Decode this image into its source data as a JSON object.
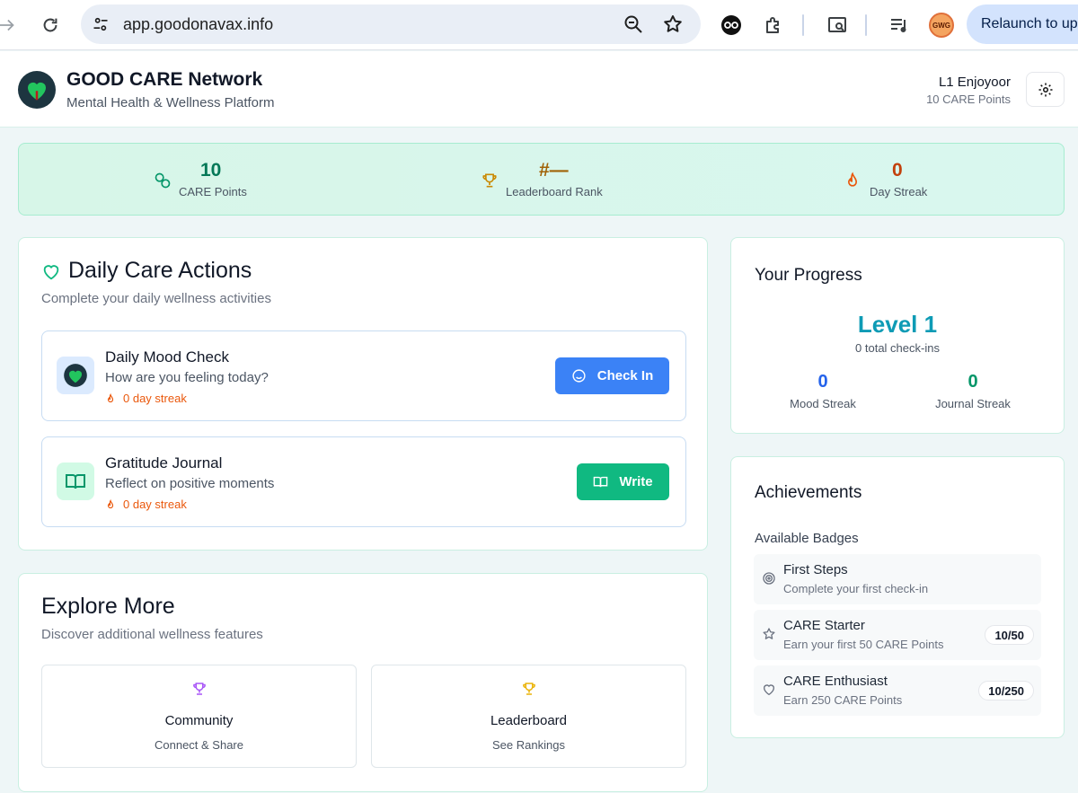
{
  "browser": {
    "url": "app.goodonavax.info",
    "relaunch_label": "Relaunch to update",
    "profile_initials": "GWG"
  },
  "header": {
    "title": "GOOD CARE Network",
    "subtitle": "Mental Health & Wellness Platform",
    "user_name": "L1 Enjoyoor",
    "user_points": "10 CARE Points"
  },
  "stats": {
    "points_value": "10",
    "points_label": "CARE Points",
    "rank_value": "#—",
    "rank_label": "Leaderboard Rank",
    "streak_value": "0",
    "streak_label": "Day Streak"
  },
  "daily": {
    "title": "Daily Care Actions",
    "subtitle": "Complete your daily wellness activities",
    "mood": {
      "title": "Daily Mood Check",
      "description": "How are you feeling today?",
      "streak": "0 day streak",
      "button": "Check In"
    },
    "journal": {
      "title": "Gratitude Journal",
      "description": "Reflect on positive moments",
      "streak": "0 day streak",
      "button": "Write"
    }
  },
  "explore": {
    "title": "Explore More",
    "subtitle": "Discover additional wellness features",
    "items": [
      {
        "title": "Community",
        "description": "Connect & Share"
      },
      {
        "title": "Leaderboard",
        "description": "See Rankings"
      }
    ]
  },
  "progress": {
    "title": "Your Progress",
    "level": "Level 1",
    "checkins": "0 total check-ins",
    "mood_streak_value": "0",
    "mood_streak_label": "Mood Streak",
    "journal_streak_value": "0",
    "journal_streak_label": "Journal Streak"
  },
  "achievements": {
    "title": "Achievements",
    "section_label": "Available Badges",
    "badges": [
      {
        "title": "First Steps",
        "description": "Complete your first check-in",
        "progress": ""
      },
      {
        "title": "CARE Starter",
        "description": "Earn your first 50 CARE Points",
        "progress": "10/50"
      },
      {
        "title": "CARE Enthusiast",
        "description": "Earn 250 CARE Points",
        "progress": "10/250"
      }
    ]
  },
  "colors": {
    "brand_green": "#10b981",
    "primary_blue": "#3b82f6",
    "level_teal": "#0e9bb5",
    "rank_gold": "#a16207",
    "streak_orange": "#c2410c",
    "points_green": "#047857"
  },
  "icons": {
    "back": "arrow-right-icon",
    "reload": "reload-icon",
    "site_settings": "tune-icon",
    "zoom": "zoom-icon",
    "bookmark": "star-icon",
    "settings": "gear-icon",
    "points": "coins-icon",
    "rank": "trophy-icon",
    "streak": "flame-icon",
    "daily": "heart-icon",
    "check_in": "smile-icon",
    "write": "book-icon"
  }
}
